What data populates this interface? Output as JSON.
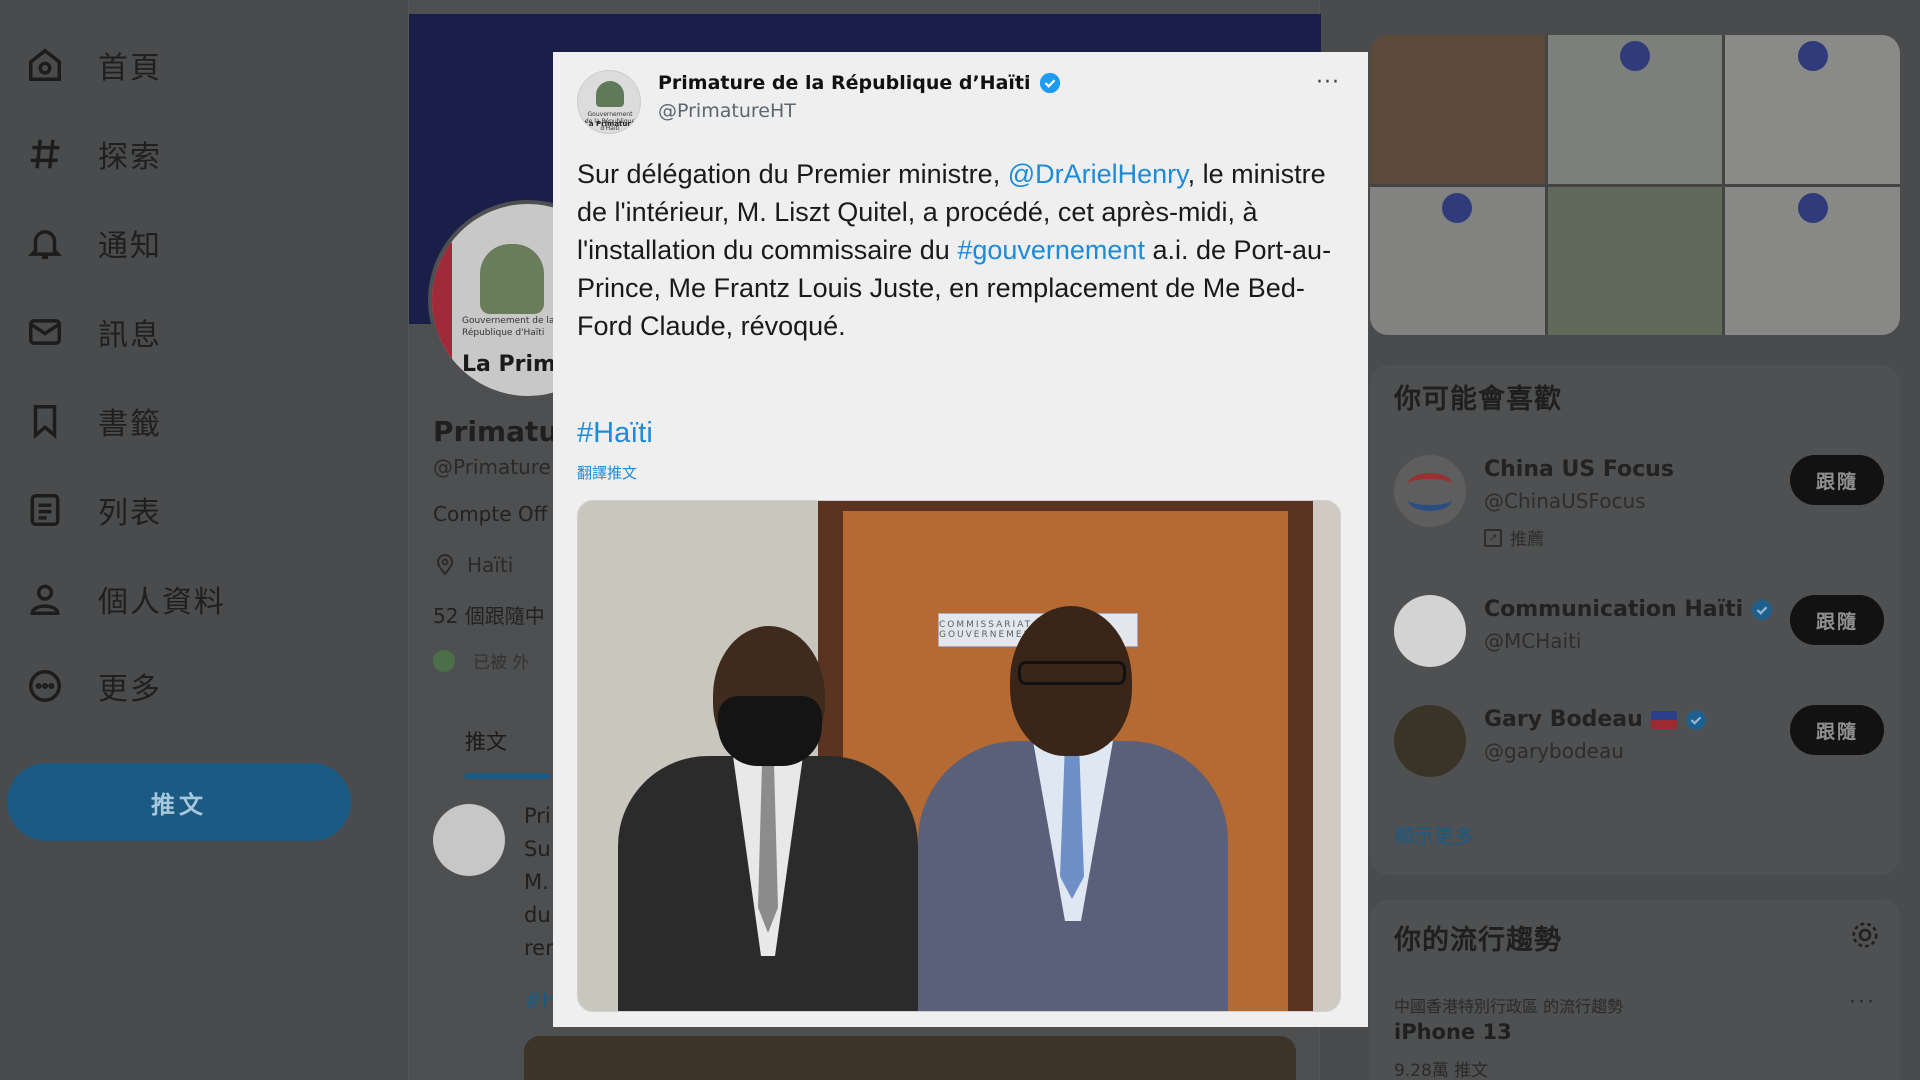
{
  "nav": {
    "items": [
      {
        "label": "首頁",
        "icon": "home-icon"
      },
      {
        "label": "探索",
        "icon": "hashtag-icon"
      },
      {
        "label": "通知",
        "icon": "bell-icon"
      },
      {
        "label": "訊息",
        "icon": "mail-icon"
      },
      {
        "label": "書籤",
        "icon": "bookmark-icon"
      },
      {
        "label": "列表",
        "icon": "list-icon"
      },
      {
        "label": "個人資料",
        "icon": "person-icon"
      },
      {
        "label": "更多",
        "icon": "more-circle-icon"
      }
    ],
    "tweet_button": "推文"
  },
  "profile": {
    "avatar_line1": "Gouvernement de la",
    "avatar_line2": "République d'Haïti",
    "avatar_line3": "La Prima",
    "name": "Primatu",
    "handle": "@Primature",
    "bio": "Compte Off",
    "location": "Haïti",
    "stats": "52 個跟隨中",
    "followed_by": "已被 外",
    "tab": "推文",
    "feed_lines": [
      "Pri",
      "Su",
      "M.",
      "du",
      "rer"
    ],
    "feed_tag": "#H"
  },
  "tweet": {
    "author_name": "Primature de la République d’Haïti",
    "author_handle": "@PrimatureHT",
    "avatar_line1": "Gouvernement de la République d'Haïti",
    "avatar_line2": "La Primature",
    "more": "···",
    "text_before_mention": "Sur délégation du Premier ministre, ",
    "mention": "@DrArielHenry",
    "text_after_mention": ", le ministre de l'intérieur, M. Liszt Quitel, a procédé, cet après-midi, à l'installation du commissaire du ",
    "hashtag_inline": "#gouvernement",
    "text_end": " a.i. de Port-au-Prince, Me Frantz Louis Juste, en remplacement de Me Bed-Ford Claude, révoqué.",
    "hashtag": "#Haïti",
    "translate": "翻譯推文",
    "door_sign": "COMMISSARIAT DU GOUVERNEMENT"
  },
  "sidebar": {
    "who_to_follow_title": "你可能會喜歡",
    "accounts": [
      {
        "name": "China US Focus",
        "handle": "@ChinaUSFocus",
        "promoted": "推薦",
        "verified": false,
        "button": "跟隨"
      },
      {
        "name": "Communication Haïti",
        "handle": "@MCHaiti",
        "verified": true,
        "button": "跟隨"
      },
      {
        "name": "Gary Bodeau",
        "handle": "@garybodeau",
        "verified": true,
        "flag": true,
        "button": "跟隨"
      }
    ],
    "show_more": "顯示更多",
    "trends_title": "你的流行趨勢",
    "trend": {
      "meta": "中國香港特別行政區 的流行趨勢",
      "name": "iPhone 13",
      "count": "9.28萬 推文",
      "more": "···"
    }
  },
  "colors": {
    "accent": "#1d8bd6",
    "dim_accent": "#1b5a82",
    "overlay_bg": "#4a4b4c",
    "card_bg": "#efefef"
  }
}
